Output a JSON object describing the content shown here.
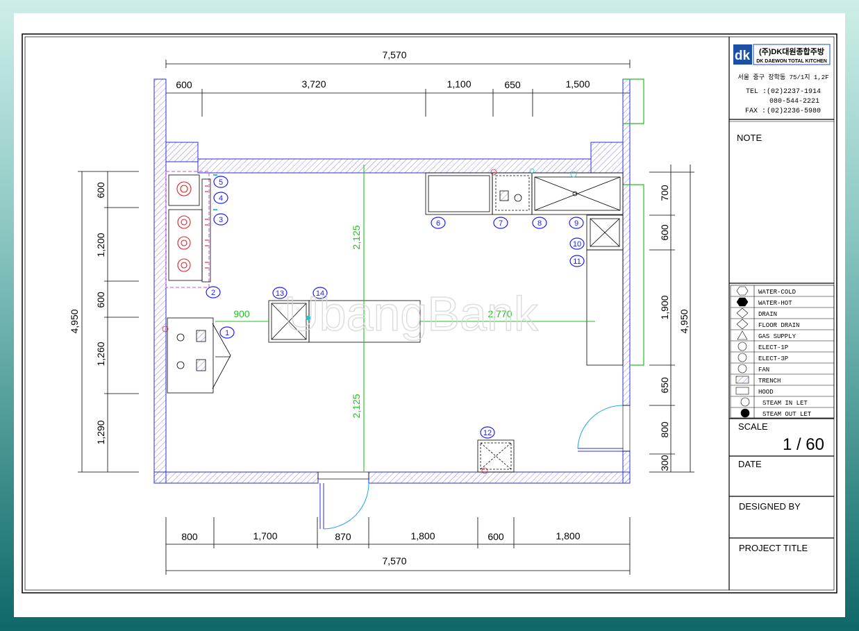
{
  "dims": {
    "top_total": "7,570",
    "top_parts": [
      "600",
      "3,720",
      "1,100",
      "650",
      "1,500"
    ],
    "bottom_total": "7,570",
    "bottom_parts": [
      "800",
      "1,700",
      "870",
      "1,800",
      "600",
      "1,800"
    ],
    "left_total": "4,950",
    "left_parts": [
      "600",
      "1,200",
      "600",
      "1,260",
      "1,290"
    ],
    "right_total": "4,950",
    "right_parts": [
      "700",
      "600",
      "1,900",
      "650",
      "800",
      "300"
    ],
    "interior": {
      "upper_vertical": "2,125",
      "lower_vertical": "2,125",
      "left_horizontal": "900",
      "right_horizontal": "2,770"
    }
  },
  "equipment_tags": [
    "1",
    "2",
    "3",
    "4",
    "5",
    "6",
    "7",
    "8",
    "9",
    "10",
    "11",
    "12",
    "13",
    "14"
  ],
  "title_block": {
    "company_name_kr": "(주)DK대원종합주방",
    "company_name_en": "DK DAEWON TOTAL KITCHEN",
    "logo_text": "dk",
    "address": "서울 중구 장학동 75/1지 1,2F",
    "tel_label": "TEL :",
    "tel_1": "(02)2237-1914",
    "tel_2": "080-544-2221",
    "fax_label": "FAX :",
    "fax": "(02)2236-5980",
    "note_label": "NOTE",
    "scale_label": "SCALE",
    "scale_value": "1 / 60",
    "date_label": "DATE",
    "designed_by_label": "DESIGNED BY",
    "project_title_label": "PROJECT TITLE"
  },
  "legend": [
    {
      "icon": "water-cold-icon",
      "label": "WATER-COLD"
    },
    {
      "icon": "water-hot-icon",
      "label": "WATER-HOT"
    },
    {
      "icon": "drain-icon",
      "label": "DRAIN"
    },
    {
      "icon": "floor-drain-icon",
      "label": "FLOOR DRAIN"
    },
    {
      "icon": "gas-supply-icon",
      "label": "GAS SUPPLY"
    },
    {
      "icon": "elect-1p-icon",
      "label": "ELECT-1P"
    },
    {
      "icon": "elect-3p-icon",
      "label": "ELECT-3P"
    },
    {
      "icon": "fan-icon",
      "label": "FAN"
    },
    {
      "icon": "trench-icon",
      "label": "TRENCH"
    },
    {
      "icon": "hood-icon",
      "label": "HOOD"
    },
    {
      "icon": "steam-inlet-icon",
      "label": "STEAM IN LET"
    },
    {
      "icon": "steam-outlet-icon",
      "label": "STEAM OUT LET"
    }
  ],
  "watermark": "UbangBank",
  "colors": {
    "dimension_green": "#1fc21f",
    "wall_outline": "#2b2bd6",
    "tag_blue": "#1a1aff",
    "burner_red": "#e0202a",
    "hood_magenta": "#e040e0",
    "supply_cyan": "#20c8c8"
  }
}
